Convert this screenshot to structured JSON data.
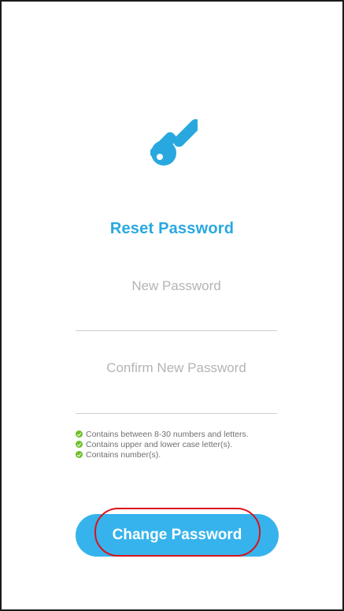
{
  "icon": "key-icon",
  "colors": {
    "accent": "#29a8e0",
    "button": "#36b3ec",
    "check": "#6bbf28",
    "highlight": "#d8141c"
  },
  "title": "Reset Password",
  "fields": {
    "new_password": {
      "placeholder": "New Password",
      "value": ""
    },
    "confirm_password": {
      "placeholder": "Confirm New Password",
      "value": ""
    }
  },
  "requirements": [
    {
      "text": "Contains between 8-30 numbers and letters.",
      "icon": "check-circle-icon"
    },
    {
      "text": "Contains upper and lower case letter(s).",
      "icon": "check-circle-icon"
    },
    {
      "text": "Contains number(s).",
      "icon": "check-circle-icon"
    }
  ],
  "button": {
    "label": "Change Password"
  }
}
